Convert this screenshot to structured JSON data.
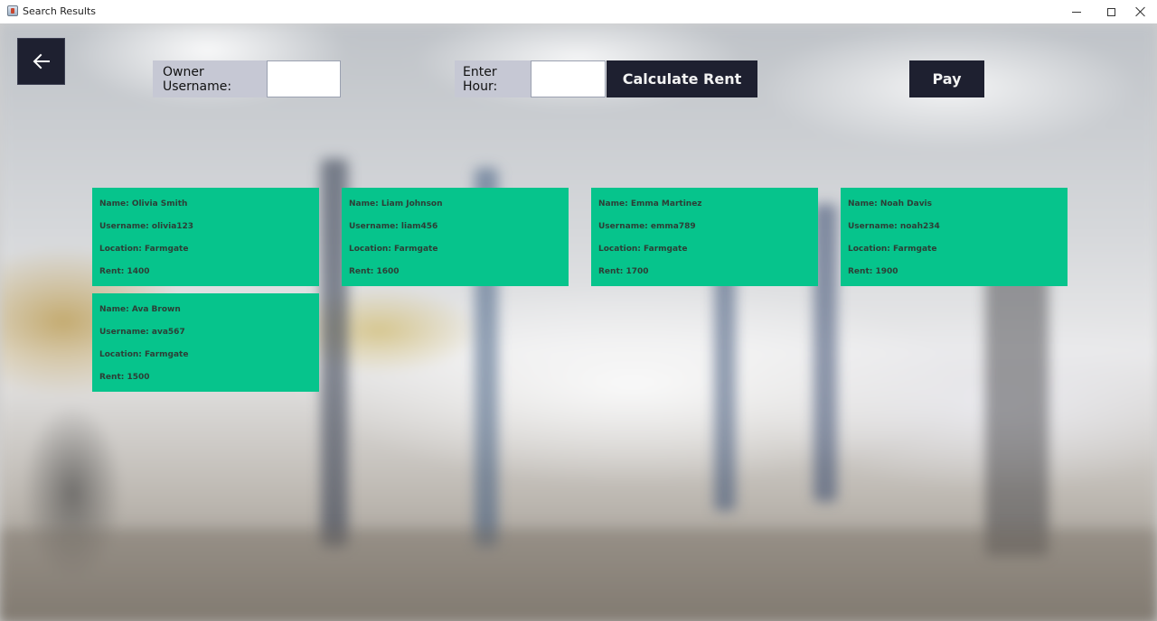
{
  "window": {
    "title": "Search Results",
    "controls": {
      "minimize_icon": "minimize-icon",
      "maximize_icon": "maximize-icon",
      "close_icon": "close-icon"
    }
  },
  "toolbar": {
    "back_icon": "arrow-left-icon",
    "owner_username_label": "Owner Username:",
    "owner_username_value": "",
    "enter_hour_label": "Enter Hour:",
    "enter_hour_value": "",
    "calculate_button_label": "Calculate Rent",
    "pay_button_label": "Pay"
  },
  "colors": {
    "card_background": "#06c48c",
    "button_background": "#1e2030",
    "label_background": "#c6c8d4"
  },
  "results": [
    {
      "name": "Name: Olivia Smith",
      "username": "Username: olivia123",
      "location": "Location: Farmgate",
      "rent": "Rent: 1400"
    },
    {
      "name": "Name: Liam Johnson",
      "username": "Username: liam456",
      "location": "Location: Farmgate",
      "rent": "Rent: 1600"
    },
    {
      "name": "Name: Emma Martinez",
      "username": "Username: emma789",
      "location": "Location: Farmgate",
      "rent": "Rent: 1700"
    },
    {
      "name": "Name: Noah Davis",
      "username": "Username: noah234",
      "location": "Location: Farmgate",
      "rent": "Rent: 1900"
    },
    {
      "name": "Name: Ava Brown",
      "username": "Username: ava567",
      "location": "Location: Farmgate",
      "rent": "Rent: 1500"
    }
  ]
}
